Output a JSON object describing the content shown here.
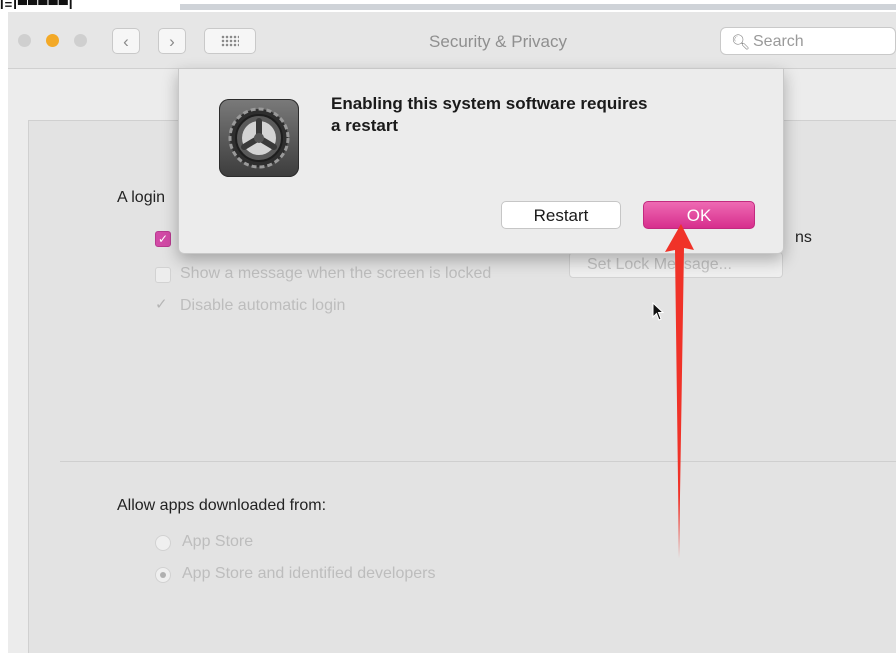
{
  "top_fragment": "I=I▀▀▀▀▀I",
  "window": {
    "title": "Security & Privacy",
    "search_placeholder": "Search",
    "nav_back": "‹",
    "nav_forward": "›"
  },
  "panel": {
    "login_heading_partial": "A login",
    "require_password_suffix": "ns",
    "show_message_label": "Show a message when the screen is locked",
    "set_lock_button": "Set Lock Message...",
    "disable_auto_login_label": "Disable automatic login",
    "allow_apps_heading": "Allow apps downloaded from:",
    "radio_app_store": "App Store",
    "radio_identified": "App Store and identified developers"
  },
  "dialog": {
    "message_line1": "Enabling this system software requires",
    "message_line2": "a restart",
    "restart_button": "Restart",
    "ok_button": "OK"
  },
  "colors": {
    "accent": "#d72e8d",
    "annotation_arrow": "#f03228"
  }
}
